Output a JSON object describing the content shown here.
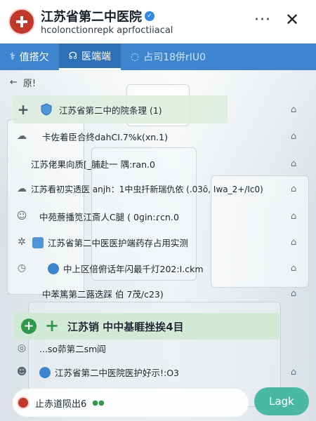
{
  "header": {
    "title": "江苏省第二中医院",
    "subtitle": "hcolonctionrepk aprfoctiiacal",
    "more_label": "···",
    "close_label": "✕"
  },
  "tabs": [
    {
      "label": "值搭欠",
      "icon": "stethoscope-icon"
    },
    {
      "label": "医端端",
      "icon": "chat-icon"
    },
    {
      "label": "占司18併rIU0",
      "icon": "message-icon"
    }
  ],
  "breadcrumb": {
    "back": "←",
    "label": "原!"
  },
  "rows": [
    {
      "text": "江苏省第二中的院条理 (1)",
      "icon": "plus-icon"
    },
    {
      "text": "卡佐着臣合终dahCI.7%k(xn.1)",
      "icon": "cloud-icon"
    },
    {
      "text": "江苏佬果向质[_脯赴一 隅:ran.0",
      "icon": "cloud-icon"
    },
    {
      "text": "江苏看初实透医 anjh：1中虫扦新瑞仇依 (.03ō,  Iwa_2+/Ic0)",
      "icon": "cloud-icon"
    },
    {
      "text": "中苑薝播笕江斎人C腿 ( 0ɡin:ɾcn.0",
      "icon": "doctor-icon"
    },
    {
      "text": "江苏省第二中医医护端药存占用实测",
      "icon": "shield-icon"
    },
    {
      "text": "中上区倍俯话年闪最千灯202:I.ckm",
      "icon": "clock-icon"
    },
    {
      "text": "中苯篤第二蕗迭踩 伯 7茂/c23)",
      "icon": "clock-icon"
    },
    {
      "text": "江苏销  中中基睚挫挨4目",
      "icon": "plus-circle-icon"
    },
    {
      "text": "...so茆第二sm阎",
      "icon": "gear-icon"
    },
    {
      "text": "江苏省第二中医院医护好示!:O3",
      "icon": "bot-icon"
    }
  ],
  "footer": {
    "chip_label": "止赤道陨出6",
    "cta_label": "Lagk"
  }
}
